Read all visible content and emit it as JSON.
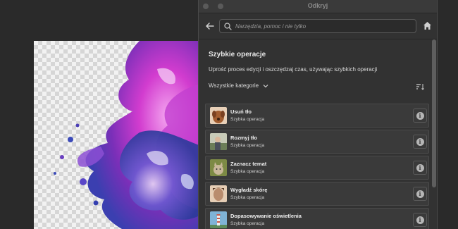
{
  "window": {
    "title": "Odkryj"
  },
  "search": {
    "placeholder": "Narzędzia, pomoc i nie tylko",
    "value": ""
  },
  "section": {
    "heading": "Szybkie operacje",
    "description": "Uprość proces edycji i oszczędzaj czas, używając szybkich operacji",
    "category_filter": "Wszystkie kategorie"
  },
  "quick_actions": [
    {
      "name": "Usuń tło",
      "type": "Szybka operacja",
      "thumb": "dog-thumbnail",
      "colors": [
        "#a25d30",
        "#e8d0b8"
      ]
    },
    {
      "name": "Rozmyj tło",
      "type": "Szybka operacja",
      "thumb": "person-thumbnail",
      "colors": [
        "#6c7e58",
        "#c8cbb8"
      ]
    },
    {
      "name": "Zaznacz temat",
      "type": "Szybka operacja",
      "thumb": "cat-thumbnail",
      "colors": [
        "#7d8a45",
        "#c9b89a"
      ]
    },
    {
      "name": "Wygładź skórę",
      "type": "Szybka operacja",
      "thumb": "face-thumbnail",
      "colors": [
        "#b98c6e",
        "#e5cdb5"
      ]
    },
    {
      "name": "Dopasowywanie oświetlenia",
      "type": "Szybka operacja",
      "thumb": "lighthouse-thumbnail",
      "colors": [
        "#7fb3d6",
        "#c85a4a"
      ]
    }
  ],
  "colors": {
    "panel_bg": "#323232",
    "item_bg": "#3a3a3a"
  }
}
